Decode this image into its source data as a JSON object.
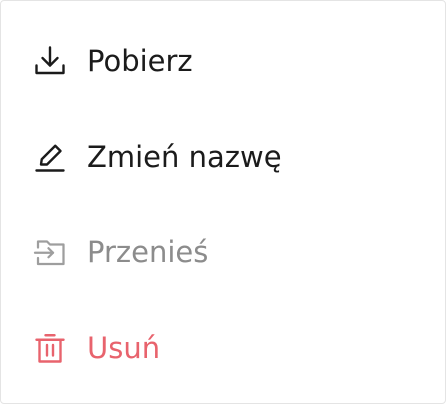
{
  "colors": {
    "text_default": "#1b1b1b",
    "text_disabled": "#8c8c8c",
    "icon_disabled": "#9e9e9e",
    "danger": "#e8636d",
    "border": "#e4e4e4"
  },
  "menu": {
    "items": [
      {
        "label": "Pobierz",
        "icon": "download-icon",
        "state": "enabled"
      },
      {
        "label": "Zmień nazwę",
        "icon": "pencil-icon",
        "state": "enabled"
      },
      {
        "label": "Przenieś",
        "icon": "folder-move-icon",
        "state": "disabled"
      },
      {
        "label": "Usuń",
        "icon": "trash-icon",
        "state": "danger"
      }
    ]
  }
}
